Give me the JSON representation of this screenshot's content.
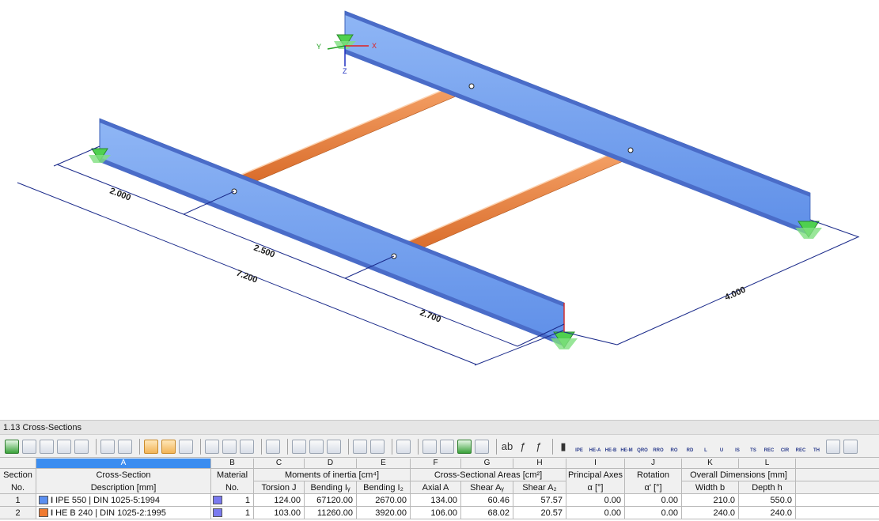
{
  "viewport": {
    "axes": {
      "x": "X",
      "y": "Y",
      "z": "Z"
    },
    "dimensions": {
      "d1": "2.000",
      "d2": "2.500",
      "d3": "2.700",
      "d4": "7.200",
      "d5": "4.000"
    },
    "colors": {
      "main_beam": "#6fa0f0",
      "secondary_beam": "#f08a48",
      "support": "#4fd04f",
      "dim_line": "#1a2a8a"
    }
  },
  "panel": {
    "title": "1.13 Cross-Sections",
    "toolbar_labels": [
      "IPE",
      "HE-A",
      "HE-B",
      "HE-M",
      "QRO",
      "RRO",
      "RO",
      "RD",
      "L",
      "U",
      "IS",
      "TS",
      "REC",
      "CIR",
      "REC",
      "TH"
    ],
    "column_letters": [
      "A",
      "B",
      "C",
      "D",
      "E",
      "F",
      "G",
      "H",
      "I",
      "J",
      "K",
      "L"
    ],
    "headers": {
      "section": "Section",
      "section_no": "No.",
      "cross_section": "Cross-Section",
      "description": "Description [mm]",
      "material": "Material",
      "material_no": "No.",
      "moments": "Moments of inertia [cm⁴]",
      "torsion": "Torsion J",
      "bending_y": "Bending Iᵧ",
      "bending_z": "Bending I₂",
      "areas": "Cross-Sectional Areas [cm²]",
      "axial": "Axial A",
      "shear_y": "Shear Aᵧ",
      "shear_z": "Shear A₂",
      "principal": "Principal Axes",
      "alpha": "α [°]",
      "rotation": "Rotation",
      "alpha_prime": "α' [°]",
      "overall": "Overall Dimensions [mm]",
      "width": "Width b",
      "depth": "Depth h"
    },
    "rows": [
      {
        "no": "1",
        "color": "#5b8ff0",
        "description": "IPE 550 | DIN 1025-5:1994",
        "material": "1",
        "torsion": "124.00",
        "bending_y": "67120.00",
        "bending_z": "2670.00",
        "axial": "134.00",
        "shear_y": "60.46",
        "shear_z": "57.57",
        "alpha": "0.00",
        "alpha_prime": "0.00",
        "width": "210.0",
        "depth": "550.0"
      },
      {
        "no": "2",
        "color": "#f07a30",
        "description": "HE B 240 | DIN 1025-2:1995",
        "material": "1",
        "torsion": "103.00",
        "bending_y": "11260.00",
        "bending_z": "3920.00",
        "axial": "106.00",
        "shear_y": "68.02",
        "shear_z": "20.57",
        "alpha": "0.00",
        "alpha_prime": "0.00",
        "width": "240.0",
        "depth": "240.0"
      }
    ]
  }
}
